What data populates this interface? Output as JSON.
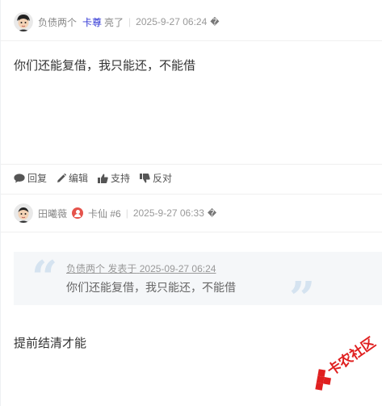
{
  "post1": {
    "author": "负债两个",
    "badge": "卡尊",
    "status": "亮了",
    "time": "2025-9-27 06:24",
    "glyph": "�",
    "content": "你们还能复借，我只能还，不能借"
  },
  "actions": [
    {
      "label": "回复",
      "icon": "comment-icon"
    },
    {
      "label": "编辑",
      "icon": "pencil-icon"
    },
    {
      "label": "支持",
      "icon": "thumbs-up-icon"
    },
    {
      "label": "反对",
      "icon": "thumbs-down-icon"
    }
  ],
  "post2": {
    "author": "田曦薇",
    "rank": "卡仙 #6",
    "time": "2025-9-27 06:33",
    "glyph": "�",
    "quote_author": "负债两个",
    "quote_label": "发表于",
    "quote_time": "2025-09-27 06:24",
    "quote_text": "你们还能复借，我只能还，不能借",
    "content": "提前结清才能"
  },
  "watermark": "卡农社区",
  "colors": {
    "badge_blue": "#2f35d4",
    "author_badge_red": "#e5534b",
    "quote_mark": "#d5e3f0",
    "watermark_red": "#e02020"
  }
}
